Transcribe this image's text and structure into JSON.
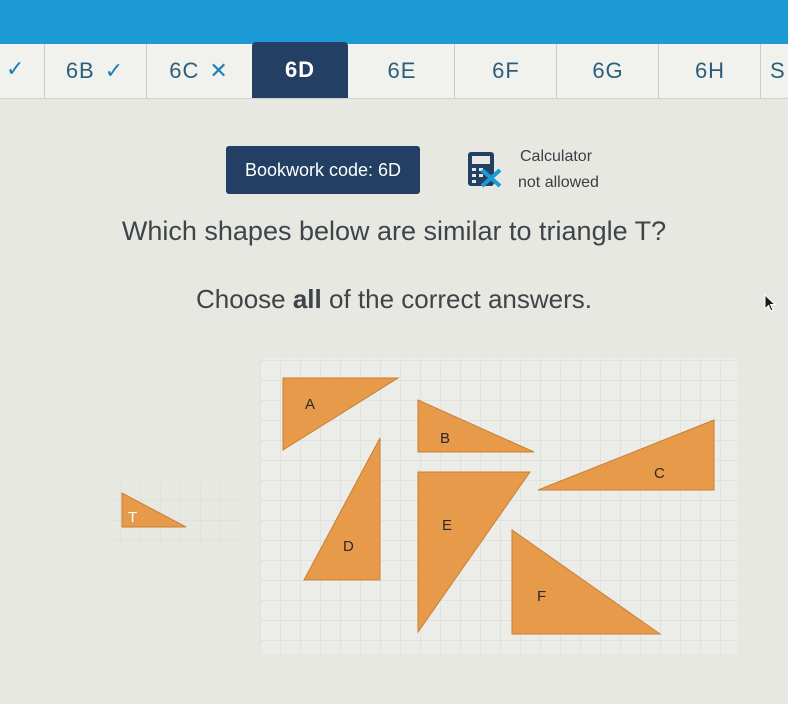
{
  "tabs": [
    {
      "label": "6B",
      "status": "correct"
    },
    {
      "label": "6C",
      "status": "incorrect"
    },
    {
      "label": "6D",
      "status": "active"
    },
    {
      "label": "6E",
      "status": "none"
    },
    {
      "label": "6F",
      "status": "none"
    },
    {
      "label": "6G",
      "status": "none"
    },
    {
      "label": "6H",
      "status": "none"
    },
    {
      "label": "S",
      "status": "none"
    }
  ],
  "header": {
    "bookwork": "Bookwork code: 6D",
    "calculator_title": "Calculator",
    "calculator_status": "not allowed"
  },
  "question": {
    "text": "Which shapes below are similar to triangle T?",
    "instruction_pre": "Choose ",
    "instruction_bold": "all",
    "instruction_post": " of the correct answers."
  },
  "shapes": {
    "T": "T",
    "A": "A",
    "B": "B",
    "C": "C",
    "D": "D",
    "E": "E",
    "F": "F"
  },
  "colors": {
    "header_blue": "#1c9ad6",
    "navy": "#233f63",
    "shape_fill": "#e79a4a",
    "grid": "#d4d6d0"
  }
}
